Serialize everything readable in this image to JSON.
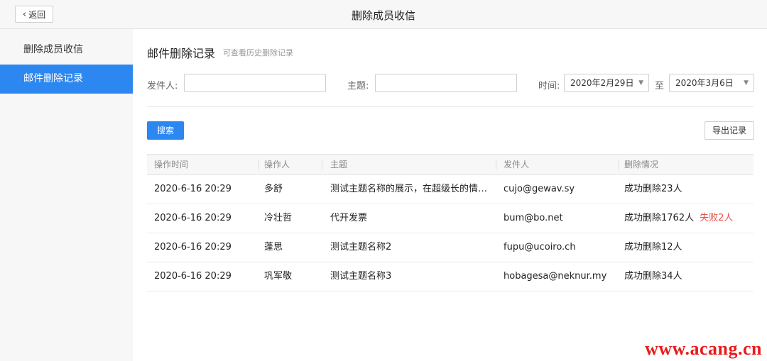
{
  "header": {
    "back_label": "返回",
    "title": "删除成员收信"
  },
  "sidebar": {
    "items": [
      {
        "label": "删除成员收信",
        "active": false
      },
      {
        "label": "邮件删除记录",
        "active": true
      }
    ]
  },
  "section": {
    "title": "邮件删除记录",
    "subtitle": "可查看历史删除记录"
  },
  "filters": {
    "sender_label": "发件人:",
    "sender_value": "",
    "subject_label": "主题:",
    "subject_value": "",
    "time_label": "时间:",
    "start_date": "2020年2月29日",
    "to_label": "至",
    "end_date": "2020年3月6日"
  },
  "actions": {
    "search_label": "搜索",
    "export_label": "导出记录"
  },
  "table": {
    "headers": [
      "操作时间",
      "操作人",
      "主题",
      "发件人",
      "删除情况"
    ],
    "rows": [
      {
        "time": "2020-6-16 20:29",
        "operator": "多舒",
        "subject": "测试主题名称的展示，在超级长的情况下",
        "sender": "cujo@gewav.sy",
        "success": "成功删除23人",
        "fail": ""
      },
      {
        "time": "2020-6-16 20:29",
        "operator": "冷壮哲",
        "subject": "代开发票",
        "sender": "bum@bo.net",
        "success": "成功删除1762人",
        "fail": "失败2人"
      },
      {
        "time": "2020-6-16 20:29",
        "operator": "蓬思",
        "subject": "测试主题名称2",
        "sender": "fupu@ucoiro.ch",
        "success": "成功删除12人",
        "fail": ""
      },
      {
        "time": "2020-6-16 20:29",
        "operator": "巩军敬",
        "subject": "测试主题名称3",
        "sender": "hobagesa@neknur.my",
        "success": "成功删除34人",
        "fail": ""
      }
    ]
  },
  "watermark": "www.acang.cn",
  "colors": {
    "accent": "#2d87f0",
    "fail": "#e8524a",
    "watermark": "#e81c1c"
  },
  "icons": {
    "back": "chevron-left-icon",
    "dropdown": "caret-down-icon"
  }
}
